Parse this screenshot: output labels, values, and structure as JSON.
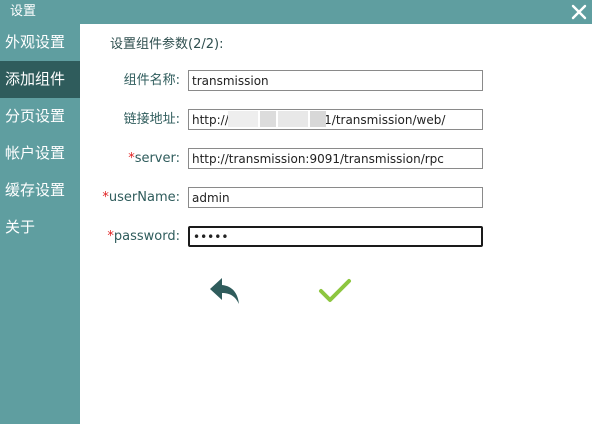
{
  "window": {
    "title": "设置",
    "close_icon": "close-icon"
  },
  "sidebar": {
    "items": [
      {
        "label": "外观设置",
        "active": false
      },
      {
        "label": "添加组件",
        "active": true
      },
      {
        "label": "分页设置",
        "active": false
      },
      {
        "label": "帐户设置",
        "active": false
      },
      {
        "label": "缓存设置",
        "active": false
      },
      {
        "label": "关于",
        "active": false
      }
    ]
  },
  "main": {
    "heading": "设置组件参数(2/2):",
    "fields": [
      {
        "label": "组件名称:",
        "required": false,
        "value": "transmission",
        "type": "text"
      },
      {
        "label": "链接地址:",
        "required": false,
        "value": "http://3                   191/transmission/web/",
        "type": "text"
      },
      {
        "label": "server:",
        "required": true,
        "value": "http://transmission:9091/transmission/rpc",
        "type": "text"
      },
      {
        "label": "userName:",
        "required": true,
        "value": "admin",
        "type": "text"
      },
      {
        "label": "password:",
        "required": true,
        "value": "•••••",
        "type": "password"
      }
    ],
    "required_mark": "*",
    "back_icon": "reply-arrow-icon",
    "confirm_icon": "checkmark-icon"
  },
  "colors": {
    "sidebar": "#5f9ea0",
    "sidebar_active": "#2f5c5c",
    "back_icon": "#2f5c5c",
    "confirm_icon": "#8dc63f",
    "required": "#e02020"
  }
}
